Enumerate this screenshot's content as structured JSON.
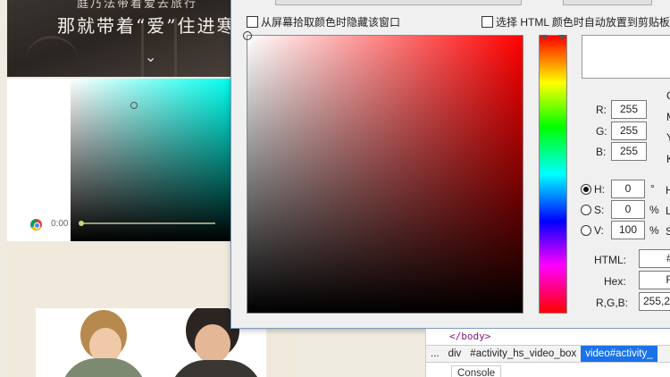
{
  "page": {
    "banner_top": "庭乃法带着爱去旅行",
    "banner_title": "那就带着“爱”住进寒",
    "video_time": "0:00"
  },
  "dialog": {
    "hide_window_label": "从屏幕拾取颜色时隐藏该窗口",
    "auto_copy_label": "选择 HTML 颜色时自动放置到剪贴板",
    "current_color": "#FFFFFF",
    "rgb": {
      "r_label": "R:",
      "r": "255",
      "g_label": "G:",
      "g": "255",
      "b_label": "B:",
      "b": "255"
    },
    "cmyk_labels": [
      "C",
      "M",
      "Y",
      "K"
    ],
    "hsv": {
      "h_label": "H:",
      "h": "0",
      "h_unit": "°",
      "h_side": "H",
      "s_label": "S:",
      "s": "0",
      "s_unit": "%",
      "s_side": "L",
      "v_label": "V:",
      "v": "100",
      "v_unit": "%",
      "v_side": "S",
      "selected": "H"
    },
    "html_label": "HTML:",
    "html_value": "#F",
    "hex_label": "Hex:",
    "hex_value": "FF",
    "rgb_combo_label": "R,G,B:",
    "rgb_combo_value": "255,2"
  },
  "devtools": {
    "code_line": "</body>",
    "breadcrumbs": [
      "...",
      "div",
      "#activity_hs_video_box",
      "video#activity_"
    ],
    "selected_crumb": "video#activity_",
    "console_tab": "Console"
  },
  "colors": {
    "sv_hue": "#ff0000",
    "video_hue": "#00ffee",
    "selection_blue": "#1a73e8"
  }
}
